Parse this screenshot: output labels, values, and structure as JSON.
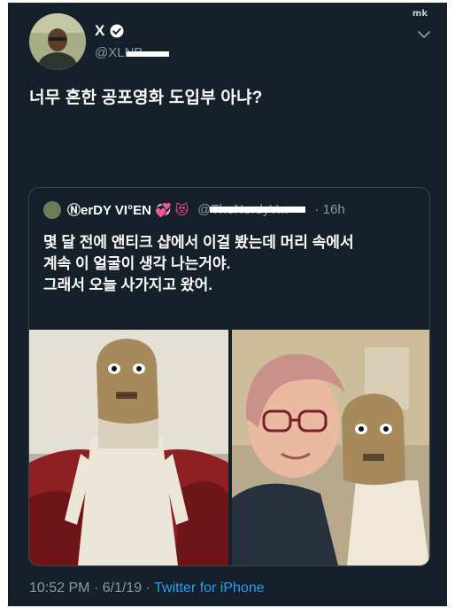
{
  "watermark": "mk",
  "author": {
    "name": "X",
    "handle": "@XLNB"
  },
  "tweet": {
    "text": "너무 흔한 공포영화 도입부 아냐?"
  },
  "quoted": {
    "name": "ⓃerDY VI°EN",
    "emoji_heart": "💞",
    "emoji_cat": "😻",
    "handle": "@TheNerdyV...",
    "time": "· 16h",
    "lines": [
      "몇 달 전에 앤티크 샵에서 이걸 봤는데 머리 속에서",
      "계속 이 얼굴이 생각 나는거야.",
      "그래서 오늘 사가지고 왔어."
    ]
  },
  "footer": {
    "time": "10:52 PM",
    "date": "· 6/1/19 ·",
    "source": "Twitter for iPhone"
  },
  "colors": {
    "background": "#15202b",
    "border": "#38444d",
    "muted": "#8899a6",
    "link": "#1da1f2"
  }
}
